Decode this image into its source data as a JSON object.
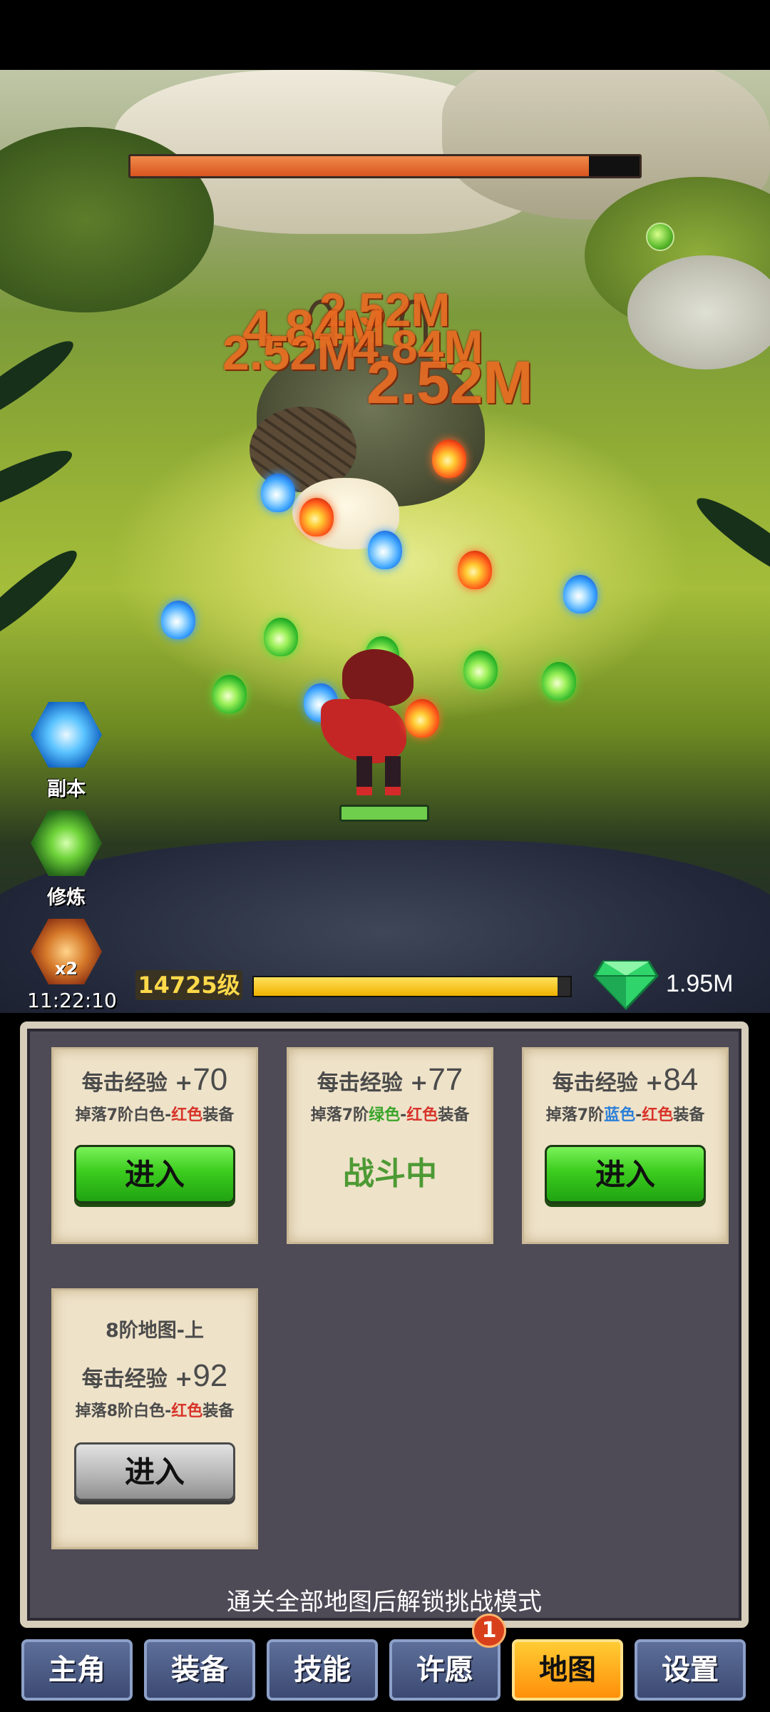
{
  "boss": {
    "hp_fraction": 0.9
  },
  "damage_numbers": [
    "2.52M",
    "4.84M",
    "2.52M",
    "4.84M",
    "2.52M"
  ],
  "player": {
    "hp_fraction": 1.0
  },
  "side_menu": {
    "dungeon_label": "副本",
    "training_label": "修炼",
    "boost_badge": "x2",
    "boost_timer": "11:22:10"
  },
  "status": {
    "level_label": "14725级",
    "exp_fraction": 0.96,
    "gems": "1.95M"
  },
  "maps": [
    {
      "exp_label": "每击经验 +",
      "exp_value": "70",
      "drop_prefix": "掉落7阶",
      "drop_from": "白色",
      "drop_from_color": "white",
      "drop_sep": "-",
      "drop_to": "红色",
      "drop_suffix": "装备",
      "action": "进入",
      "state": "enter"
    },
    {
      "exp_label": "每击经验 +",
      "exp_value": "77",
      "drop_prefix": "掉落7阶",
      "drop_from": "绿色",
      "drop_from_color": "green",
      "drop_sep": "-",
      "drop_to": "红色",
      "drop_suffix": "装备",
      "action": "战斗中",
      "state": "fighting"
    },
    {
      "exp_label": "每击经验 +",
      "exp_value": "84",
      "drop_prefix": "掉落7阶",
      "drop_from": "蓝色",
      "drop_from_color": "blue",
      "drop_sep": "-",
      "drop_to": "红色",
      "drop_suffix": "装备",
      "action": "进入",
      "state": "enter"
    },
    {
      "title": "8阶地图-上",
      "exp_label": "每击经验 +",
      "exp_value": "92",
      "drop_prefix": "掉落8阶",
      "drop_from": "白色",
      "drop_from_color": "white",
      "drop_sep": "-",
      "drop_to": "红色",
      "drop_suffix": "装备",
      "action": "进入",
      "state": "locked"
    }
  ],
  "panel_note": "通关全部地图后解锁挑战模式",
  "nav": {
    "tabs": [
      "主角",
      "装备",
      "技能",
      "许愿",
      "地图",
      "设置"
    ],
    "active": "地图",
    "badge": "1"
  }
}
